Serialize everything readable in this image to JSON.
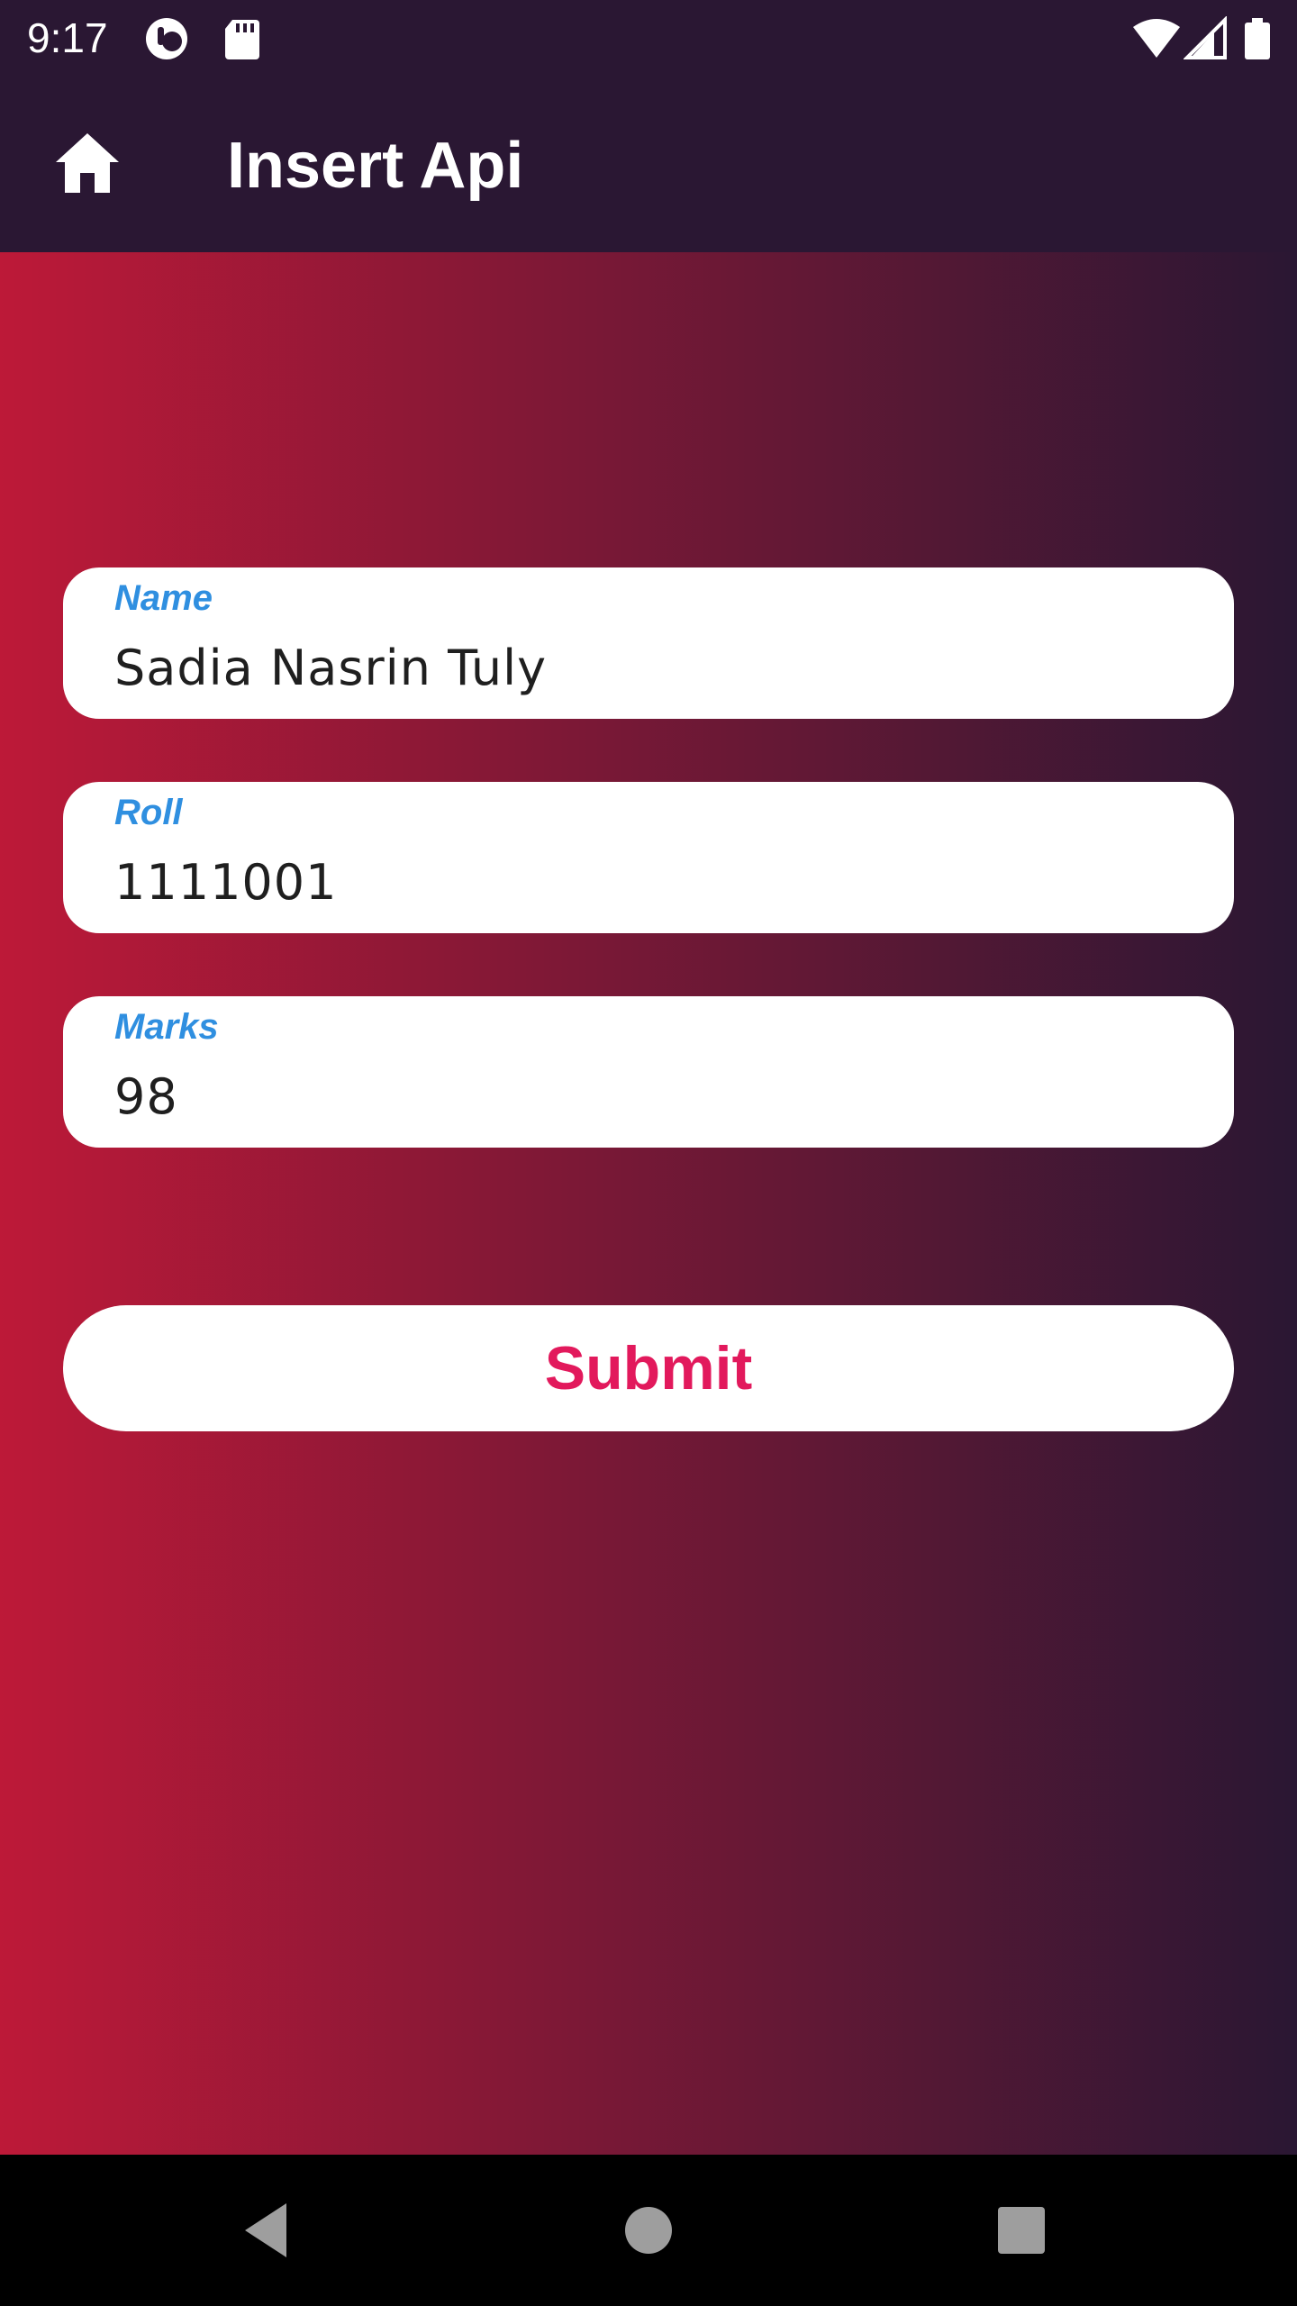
{
  "status_bar": {
    "time": "9:17",
    "icons": [
      "notification-app-icon",
      "sd-card-icon",
      "wifi-icon",
      "signal-icon",
      "battery-icon"
    ]
  },
  "app_bar": {
    "title": "Insert Api",
    "home_icon": "home-icon"
  },
  "form": {
    "background_gradient": [
      "#bd1938",
      "#2a1733"
    ],
    "label_color": "#2f8fe0",
    "fields": [
      {
        "label": "Name",
        "value": "Sadia Nasrin Tuly"
      },
      {
        "label": "Roll",
        "value": "1111001"
      },
      {
        "label": "Marks",
        "value": "98"
      }
    ],
    "submit_label": "Submit",
    "submit_color": "#e2195c"
  },
  "nav_bar": {
    "buttons": [
      "back-icon",
      "home-circle-icon",
      "recents-icon"
    ]
  }
}
